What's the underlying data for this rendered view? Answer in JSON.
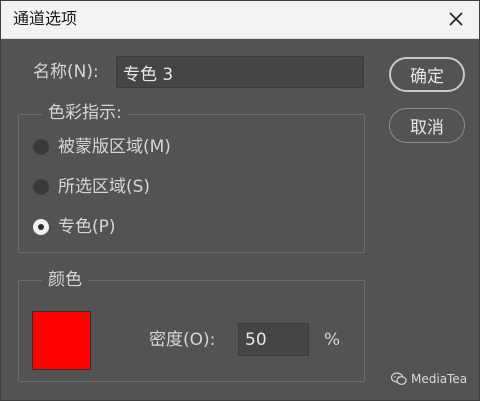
{
  "dialog": {
    "title": "通道选项",
    "close_icon": "close-icon"
  },
  "name_field": {
    "label": "名称(N):",
    "value": "专色 3"
  },
  "buttons": {
    "ok_label": "确定",
    "cancel_label": "取消"
  },
  "color_indicates": {
    "legend": "色彩指示:",
    "options": [
      {
        "label": "被蒙版区域(M)",
        "checked": false
      },
      {
        "label": "所选区域(S)",
        "checked": false
      },
      {
        "label": "专色(P)",
        "checked": true
      }
    ]
  },
  "color_group": {
    "legend": "颜色",
    "swatch_color": "#ff0000",
    "density_label": "密度(O):",
    "density_value": "50",
    "density_unit": "%"
  },
  "watermark": {
    "icon": "wechat-icon",
    "text": "MediaTea"
  }
}
